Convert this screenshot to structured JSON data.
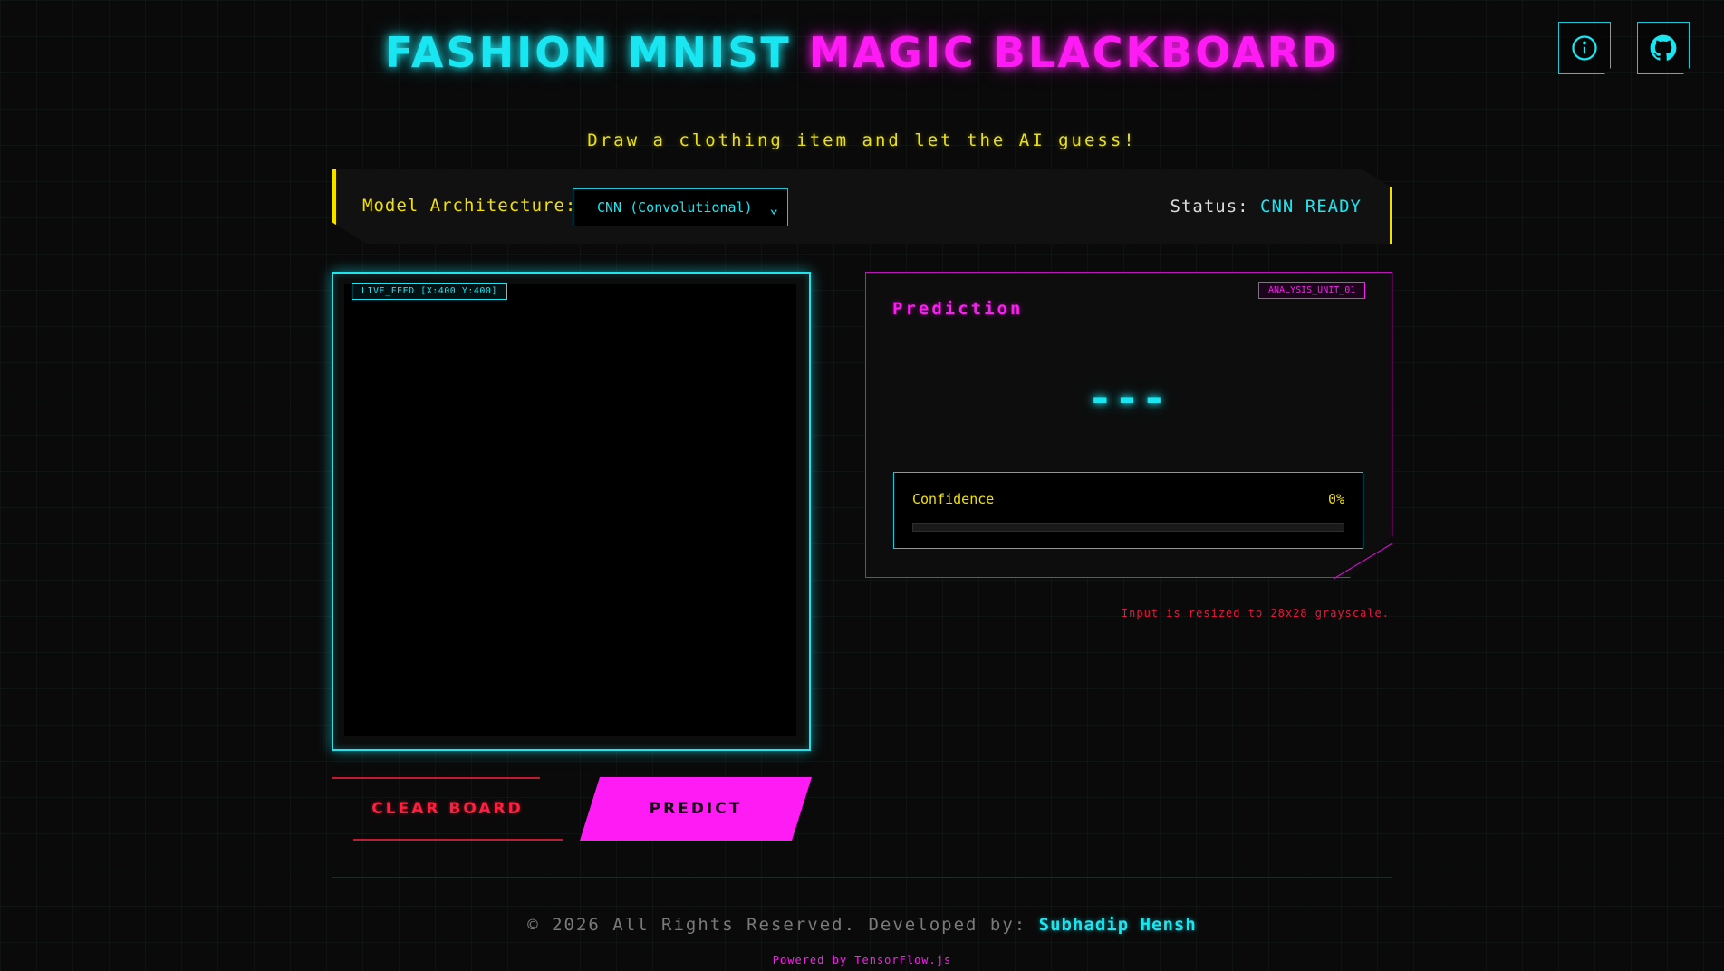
{
  "header": {
    "title_part1": "FASHION MNIST ",
    "title_part2": "MAGIC BLACKBOARD",
    "subtitle": "Draw a clothing item and let the AI guess!"
  },
  "top_icons": [
    {
      "name": "info-icon"
    },
    {
      "name": "github-icon"
    }
  ],
  "controls": {
    "model_label": "Model Architecture:",
    "model_selected": "CNN (Convolutional)",
    "status_label": "Status:",
    "status_value": "CNN READY"
  },
  "canvas": {
    "live_feed_label": "LIVE_FEED [X:400 Y:400]"
  },
  "prediction": {
    "badge": "ANALYSIS_UNIT_01",
    "label": "Prediction",
    "value": "---",
    "confidence_label": "Confidence",
    "confidence_value": "0%",
    "confidence_fraction": 0
  },
  "note": "Input is resized to 28x28 grayscale.",
  "buttons": {
    "clear_label": "CLEAR BOARD",
    "predict_label": "PREDICT"
  },
  "footer": {
    "copyright": "© 2026 All Rights Reserved. Developed by: ",
    "author": "Subhadip Hensh",
    "powered": "Powered by TensorFlow.js"
  },
  "colors": {
    "cyan": "#19e6f0",
    "magenta": "#ff1cf4",
    "yellow": "#f2e100",
    "red": "#ff2040",
    "background": "#0a0a0a"
  }
}
